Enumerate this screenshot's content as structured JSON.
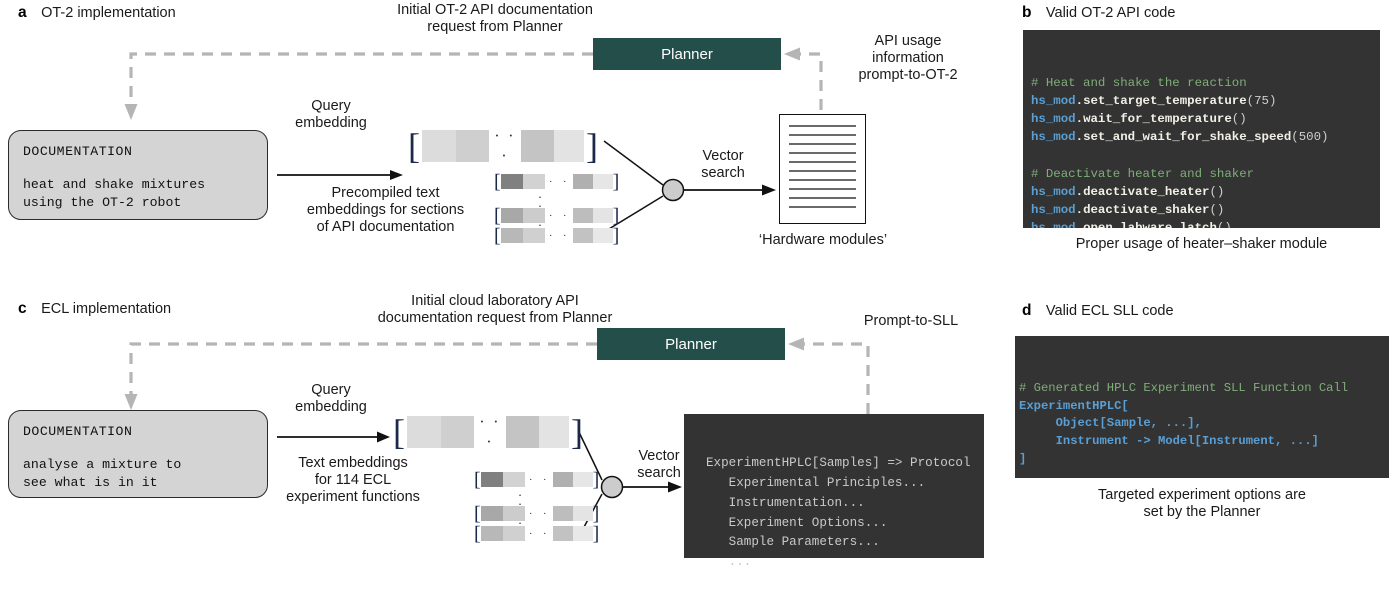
{
  "panels": {
    "a": {
      "letter": "a",
      "title": "OT-2 implementation"
    },
    "b": {
      "letter": "b",
      "title": "Valid OT-2 API code"
    },
    "c": {
      "letter": "c",
      "title": "ECL implementation"
    },
    "d": {
      "letter": "d",
      "title": "Valid ECL SLL code"
    }
  },
  "panel_a": {
    "request_label_line1": "Initial OT-2 API documentation",
    "request_label_line2": "request from Planner",
    "planner_label": "Planner",
    "api_usage_line1": "API usage",
    "api_usage_line2": "information",
    "api_usage_line3": "prompt-to-OT-2",
    "doc_heading": "DOCUMENTATION",
    "doc_line1": "heat and shake mixtures",
    "doc_line2": "using the OT-2 robot",
    "query_embedding_line1": "Query",
    "query_embedding_line2": "embedding",
    "precompiled_line1": "Precompiled text",
    "precompiled_line2": "embeddings for sections",
    "precompiled_line3": "of API documentation",
    "vector_search_line1": "Vector",
    "vector_search_line2": "search",
    "hardware_modules": "‘Hardware modules’"
  },
  "panel_b": {
    "caption": "Proper usage of heater–shaker module",
    "code": [
      {
        "type": "comment",
        "text": "# Heat and shake the reaction"
      },
      {
        "type": "call",
        "module": "hs_mod",
        "dot": ".",
        "fn": "set_target_temperature",
        "args": "(75)"
      },
      {
        "type": "call",
        "module": "hs_mod",
        "dot": ".",
        "fn": "wait_for_temperature",
        "args": "()"
      },
      {
        "type": "call",
        "module": "hs_mod",
        "dot": ".",
        "fn": "set_and_wait_for_shake_speed",
        "args": "(500)"
      },
      {
        "type": "blank",
        "text": ""
      },
      {
        "type": "comment",
        "text": "# Deactivate heater and shaker"
      },
      {
        "type": "call",
        "module": "hs_mod",
        "dot": ".",
        "fn": "deactivate_heater",
        "args": "()"
      },
      {
        "type": "call",
        "module": "hs_mod",
        "dot": ".",
        "fn": "deactivate_shaker",
        "args": "()"
      },
      {
        "type": "call",
        "module": "hs_mod",
        "dot": ".",
        "fn": "open_labware_latch",
        "args": "()"
      }
    ]
  },
  "panel_c": {
    "request_label_line1": "Initial cloud laboratory API",
    "request_label_line2": "documentation request from Planner",
    "planner_label": "Planner",
    "prompt_to_sll": "Prompt-to-SLL",
    "doc_heading": "DOCUMENTATION",
    "doc_line1": "analyse a mixture to",
    "doc_line2": "see what is in it",
    "query_embedding_line1": "Query",
    "query_embedding_line2": "embedding",
    "text_embeddings_line1": "Text embeddings",
    "text_embeddings_line2": "for 114 ECL",
    "text_embeddings_line3": "experiment functions",
    "vector_search_line1": "Vector",
    "vector_search_line2": "search",
    "protocol_lines": [
      "ExperimentHPLC[Samples] => Protocol",
      "   Experimental Principles...",
      "   Instrumentation...",
      "   Experiment Options...",
      "   Sample Parameters...",
      "   ..."
    ]
  },
  "panel_d": {
    "caption_line1": "Targeted experiment options are",
    "caption_line2": "set by the Planner",
    "code_comment": "# Generated HPLC Experiment SLL Function Call",
    "code_lines": [
      "ExperimentHPLC[",
      "     Object[Sample, ...],",
      "     Instrument -> Model[Instrument, ...]",
      "]"
    ]
  },
  "colors": {
    "planner_box": "#234E4A",
    "code_background": "#333333",
    "comment_green": "#7fae79",
    "module_blue": "#5a9fd4",
    "doc_box_fill": "#d4d4d4",
    "dashed_gray": "#b5b5b5",
    "node_fill": "#cccccc"
  },
  "embeddings": {
    "query_vector_cells_a": [
      "#dcdcdc",
      "#cfcfcf",
      "#c4c4c4",
      "#e3e3e3"
    ],
    "doc_vector_rows_a": [
      [
        "#808080",
        "#d2d2d2",
        "#b0b0b0",
        "#e6e6e6"
      ],
      [
        "#a8a8a8",
        "#cccccc",
        "#bdbdbd",
        "#e4e4e4"
      ],
      [
        "#b8b8b8",
        "#d0d0d0",
        "#c2c2c2",
        "#e8e8e8"
      ]
    ],
    "query_vector_cells_c": [
      "#dcdcdc",
      "#cfcfcf",
      "#c4c4c4",
      "#e3e3e3"
    ],
    "doc_vector_rows_c": [
      [
        "#808080",
        "#d2d2d2",
        "#b0b0b0",
        "#e6e6e6"
      ],
      [
        "#a8a8a8",
        "#cccccc",
        "#bdbdbd",
        "#e4e4e4"
      ],
      [
        "#b8b8b8",
        "#d0d0d0",
        "#c2c2c2",
        "#e8e8e8"
      ]
    ],
    "ellipsis": "· · ·"
  }
}
